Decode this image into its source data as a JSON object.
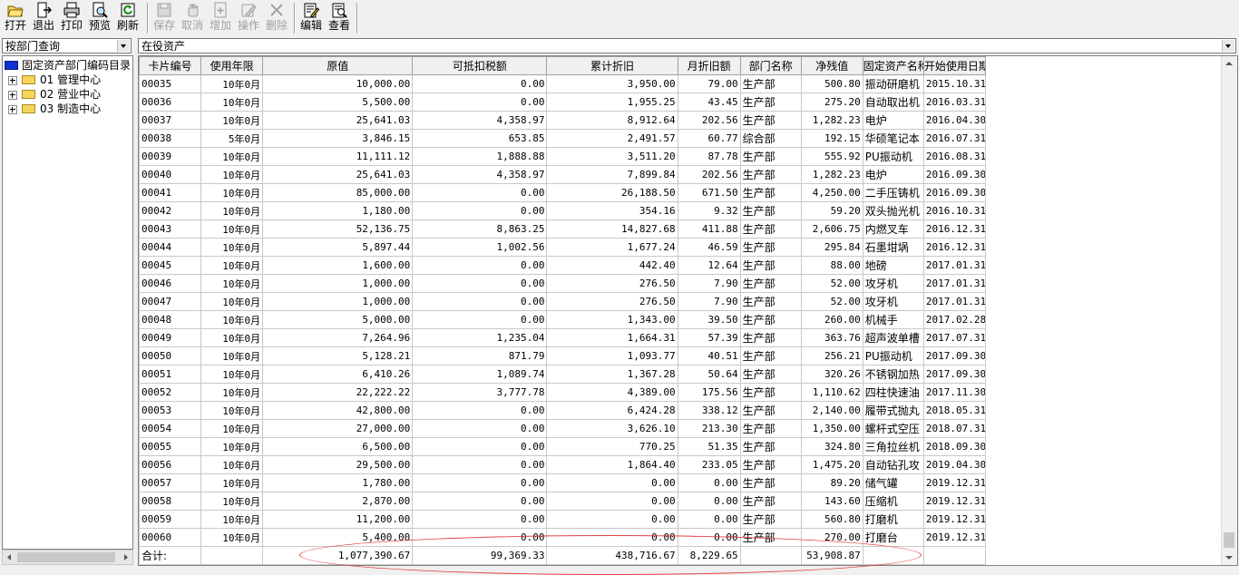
{
  "toolbar": {
    "open": "打开",
    "exit": "退出",
    "print": "打印",
    "preview": "预览",
    "refresh": "刷新",
    "save": "保存",
    "cancel": "取消",
    "add": "增加",
    "operate": "操作",
    "delete": "删除",
    "edit": "编辑",
    "view": "查看"
  },
  "left_combo": "按部门查询",
  "main_combo": "在役资产",
  "tree": {
    "root": "固定资产部门编码目录",
    "items": [
      "01 管理中心",
      "02 营业中心",
      "03 制造中心"
    ]
  },
  "table": {
    "headers": [
      "卡片编号",
      "使用年限",
      "原值",
      "可抵扣税额",
      "累计折旧",
      "月折旧额",
      "部门名称",
      "净残值",
      "固定资产名称",
      "开始使用日期"
    ],
    "rows": [
      [
        "00035",
        "10年0月",
        "10,000.00",
        "0.00",
        "3,950.00",
        "79.00",
        "生产部",
        "500.80",
        "振动研磨机",
        "2015.10.31"
      ],
      [
        "00036",
        "10年0月",
        "5,500.00",
        "0.00",
        "1,955.25",
        "43.45",
        "生产部",
        "275.20",
        "自动取出机",
        "2016.03.31"
      ],
      [
        "00037",
        "10年0月",
        "25,641.03",
        "4,358.97",
        "8,912.64",
        "202.56",
        "生产部",
        "1,282.23",
        "电炉",
        "2016.04.30"
      ],
      [
        "00038",
        "5年0月",
        "3,846.15",
        "653.85",
        "2,491.57",
        "60.77",
        "综合部",
        "192.15",
        "华硕笔记本",
        "2016.07.31"
      ],
      [
        "00039",
        "10年0月",
        "11,111.12",
        "1,888.88",
        "3,511.20",
        "87.78",
        "生产部",
        "555.92",
        "PU振动机",
        "2016.08.31"
      ],
      [
        "00040",
        "10年0月",
        "25,641.03",
        "4,358.97",
        "7,899.84",
        "202.56",
        "生产部",
        "1,282.23",
        "电炉",
        "2016.09.30"
      ],
      [
        "00041",
        "10年0月",
        "85,000.00",
        "0.00",
        "26,188.50",
        "671.50",
        "生产部",
        "4,250.00",
        "二手压铸机",
        "2016.09.30"
      ],
      [
        "00042",
        "10年0月",
        "1,180.00",
        "0.00",
        "354.16",
        "9.32",
        "生产部",
        "59.20",
        "双头抛光机",
        "2016.10.31"
      ],
      [
        "00043",
        "10年0月",
        "52,136.75",
        "8,863.25",
        "14,827.68",
        "411.88",
        "生产部",
        "2,606.75",
        "内燃叉车",
        "2016.12.31"
      ],
      [
        "00044",
        "10年0月",
        "5,897.44",
        "1,002.56",
        "1,677.24",
        "46.59",
        "生产部",
        "295.84",
        "石墨坩埚",
        "2016.12.31"
      ],
      [
        "00045",
        "10年0月",
        "1,600.00",
        "0.00",
        "442.40",
        "12.64",
        "生产部",
        "88.00",
        "地磅",
        "2017.01.31"
      ],
      [
        "00046",
        "10年0月",
        "1,000.00",
        "0.00",
        "276.50",
        "7.90",
        "生产部",
        "52.00",
        "攻牙机",
        "2017.01.31"
      ],
      [
        "00047",
        "10年0月",
        "1,000.00",
        "0.00",
        "276.50",
        "7.90",
        "生产部",
        "52.00",
        "攻牙机",
        "2017.01.31"
      ],
      [
        "00048",
        "10年0月",
        "5,000.00",
        "0.00",
        "1,343.00",
        "39.50",
        "生产部",
        "260.00",
        "机械手",
        "2017.02.28"
      ],
      [
        "00049",
        "10年0月",
        "7,264.96",
        "1,235.04",
        "1,664.31",
        "57.39",
        "生产部",
        "363.76",
        "超声波单槽",
        "2017.07.31"
      ],
      [
        "00050",
        "10年0月",
        "5,128.21",
        "871.79",
        "1,093.77",
        "40.51",
        "生产部",
        "256.21",
        "PU振动机",
        "2017.09.30"
      ],
      [
        "00051",
        "10年0月",
        "6,410.26",
        "1,089.74",
        "1,367.28",
        "50.64",
        "生产部",
        "320.26",
        "不锈钢加热",
        "2017.09.30"
      ],
      [
        "00052",
        "10年0月",
        "22,222.22",
        "3,777.78",
        "4,389.00",
        "175.56",
        "生产部",
        "1,110.62",
        "四柱快速油",
        "2017.11.30"
      ],
      [
        "00053",
        "10年0月",
        "42,800.00",
        "0.00",
        "6,424.28",
        "338.12",
        "生产部",
        "2,140.00",
        "履带式抛丸",
        "2018.05.31"
      ],
      [
        "00054",
        "10年0月",
        "27,000.00",
        "0.00",
        "3,626.10",
        "213.30",
        "生产部",
        "1,350.00",
        "螺杆式空压",
        "2018.07.31"
      ],
      [
        "00055",
        "10年0月",
        "6,500.00",
        "0.00",
        "770.25",
        "51.35",
        "生产部",
        "324.80",
        "三角拉丝机",
        "2018.09.30"
      ],
      [
        "00056",
        "10年0月",
        "29,500.00",
        "0.00",
        "1,864.40",
        "233.05",
        "生产部",
        "1,475.20",
        "自动钻孔攻",
        "2019.04.30"
      ],
      [
        "00057",
        "10年0月",
        "1,780.00",
        "0.00",
        "0.00",
        "0.00",
        "生产部",
        "89.20",
        "储气罐",
        "2019.12.31"
      ],
      [
        "00058",
        "10年0月",
        "2,870.00",
        "0.00",
        "0.00",
        "0.00",
        "生产部",
        "143.60",
        "压缩机",
        "2019.12.31"
      ],
      [
        "00059",
        "10年0月",
        "11,200.00",
        "0.00",
        "0.00",
        "0.00",
        "生产部",
        "560.80",
        "打磨机",
        "2019.12.31"
      ],
      [
        "00060",
        "10年0月",
        "5,400.00",
        "0.00",
        "0.00",
        "0.00",
        "生产部",
        "270.00",
        "打磨台",
        "2019.12.31"
      ]
    ],
    "total": [
      "合计:",
      "",
      "1,077,390.67",
      "99,369.33",
      "438,716.67",
      "8,229.65",
      "",
      "53,908.87",
      "",
      ""
    ]
  }
}
